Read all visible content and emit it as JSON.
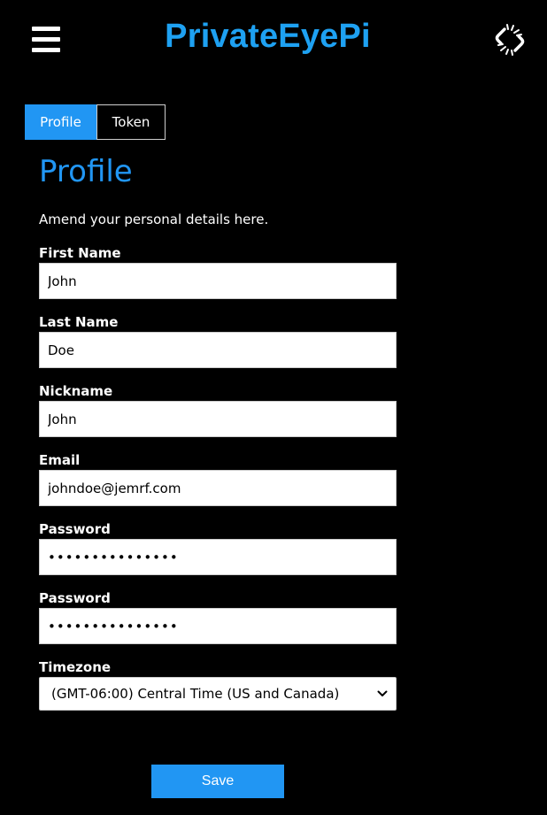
{
  "header": {
    "brand": "PrivateEyePi",
    "menu_icon": "hamburger-menu-icon",
    "link_icon": "broken-link-icon"
  },
  "tabs": [
    {
      "label": "Profile",
      "active": true
    },
    {
      "label": "Token",
      "active": false
    }
  ],
  "profile": {
    "title": "Profile",
    "intro": "Amend your personal details here.",
    "fields": {
      "first_name": {
        "label": "First Name",
        "value": "John"
      },
      "last_name": {
        "label": "Last Name",
        "value": "Doe"
      },
      "nickname": {
        "label": "Nickname",
        "value": "John"
      },
      "email": {
        "label": "Email",
        "value": "johndoe@jemrf.com"
      },
      "password": {
        "label": "Password",
        "value": "•••••••••••••••"
      },
      "password_confirm": {
        "label": "Password",
        "value": "•••••••••••••••"
      },
      "timezone": {
        "label": "Timezone",
        "value": "(GMT-06:00) Central Time (US and Canada)"
      }
    },
    "save_label": "Save"
  },
  "colors": {
    "accent": "#2196f3",
    "brand": "#1ea1f2",
    "background": "#000000"
  }
}
